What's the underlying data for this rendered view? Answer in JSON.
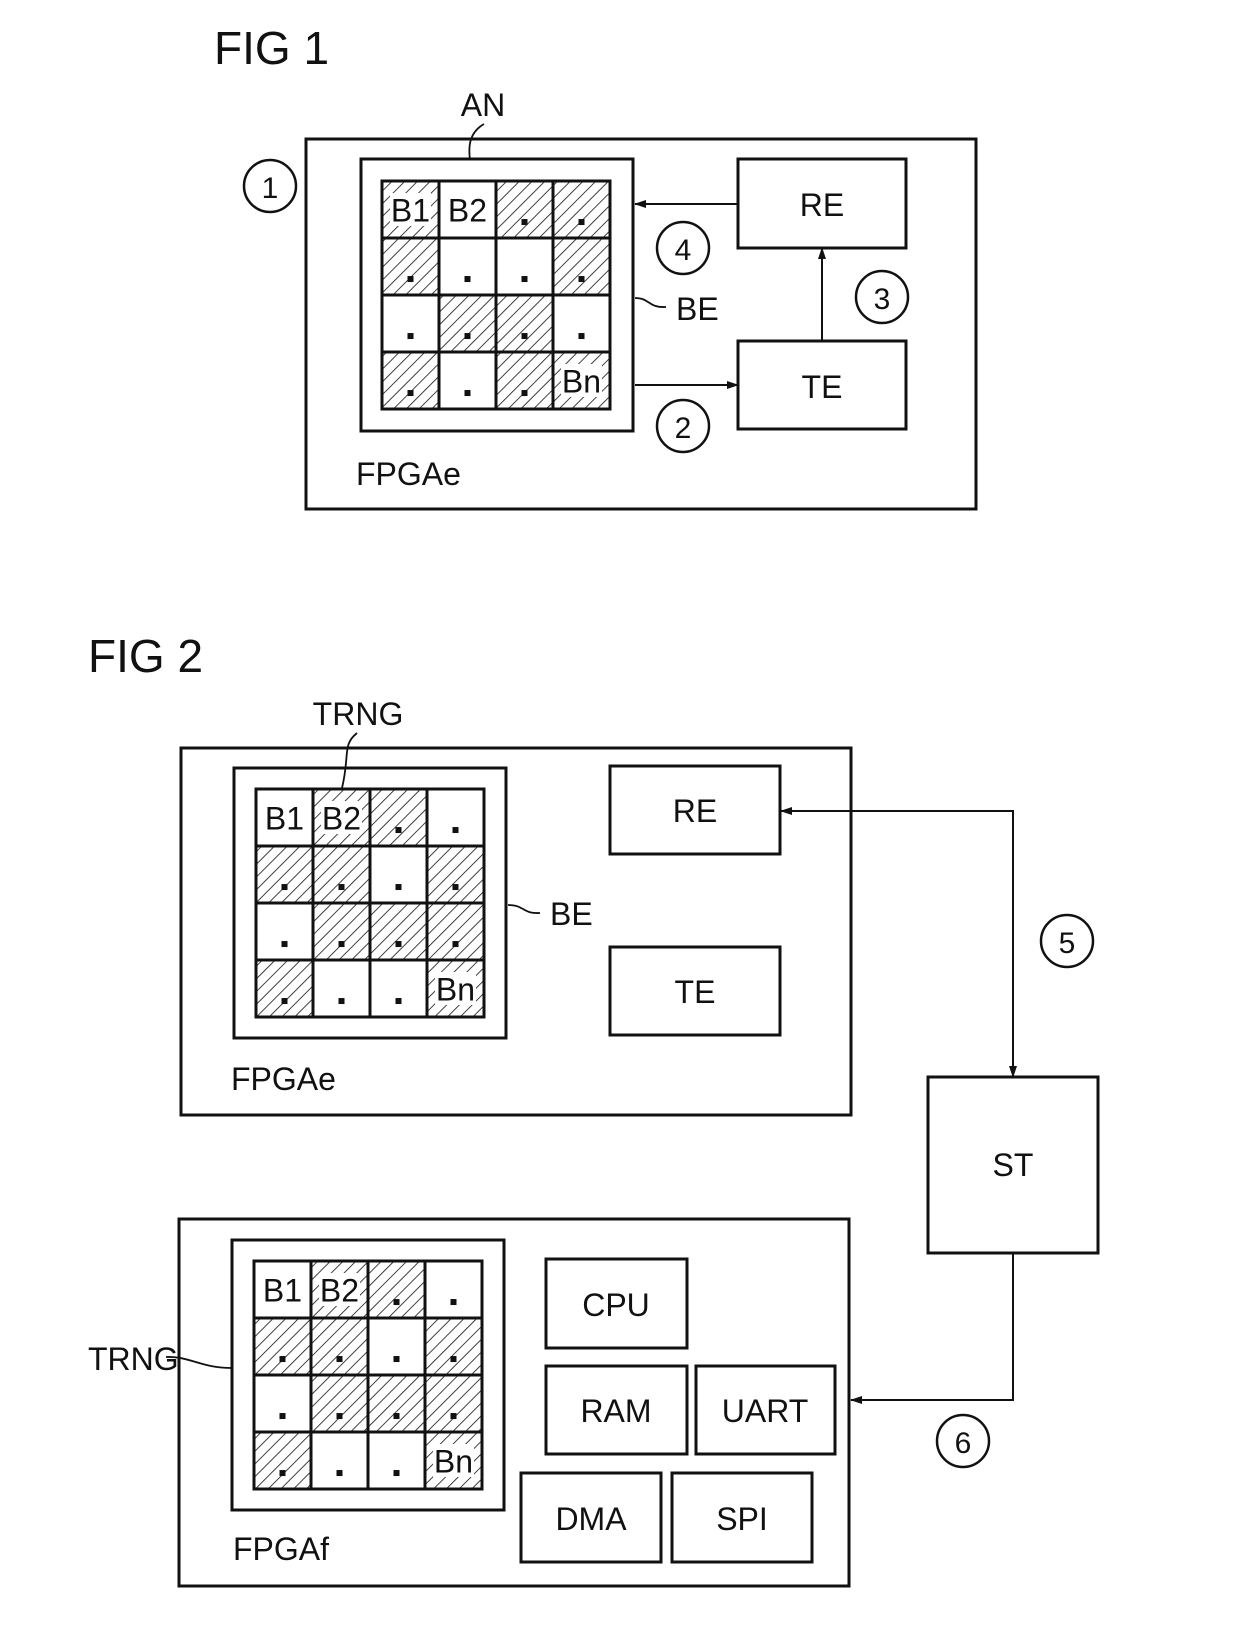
{
  "fig1": {
    "title": "FIG 1",
    "step_circle_1": "1",
    "annotation_an": "AN",
    "label_be": "BE",
    "label_fpga": "FPGAe",
    "re": "RE",
    "te": "TE",
    "steps": [
      "2",
      "3",
      "4"
    ],
    "grid": {
      "labels": {
        "0": "B1",
        "1": "B2",
        "15": "Bn"
      },
      "hatched": [
        1,
        0,
        1,
        1,
        1,
        0,
        0,
        1,
        0,
        1,
        1,
        0,
        1,
        0,
        1,
        1
      ]
    }
  },
  "fig2": {
    "title": "FIG 2",
    "top": {
      "annotation_trng": "TRNG",
      "label_be": "BE",
      "label_fpga": "FPGAe",
      "re": "RE",
      "te": "TE",
      "grid": {
        "labels": {
          "0": "B1",
          "1": "B2",
          "15": "Bn"
        },
        "hatched": [
          0,
          1,
          1,
          0,
          1,
          1,
          0,
          1,
          0,
          1,
          1,
          1,
          1,
          0,
          0,
          1
        ]
      }
    },
    "st": "ST",
    "steps": [
      "5",
      "6"
    ],
    "bottom": {
      "annotation_trng": "TRNG",
      "label_fpga": "FPGAf",
      "blocks": [
        "CPU",
        "RAM",
        "UART",
        "DMA",
        "SPI"
      ],
      "grid": {
        "labels": {
          "0": "B1",
          "1": "B2",
          "15": "Bn"
        },
        "hatched": [
          0,
          1,
          1,
          0,
          1,
          1,
          0,
          1,
          0,
          1,
          1,
          1,
          1,
          0,
          0,
          1
        ]
      }
    }
  }
}
